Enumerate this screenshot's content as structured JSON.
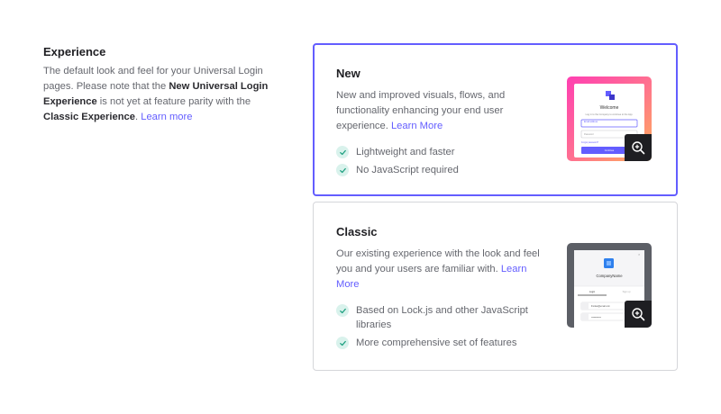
{
  "experience": {
    "title": "Experience",
    "desc_1": "The default look and feel for your Universal Login pages. Please note that the ",
    "desc_bold_1": "New Universal Login Experience",
    "desc_2": " is not yet at feature parity with the ",
    "desc_bold_2": "Classic Experience",
    "desc_3": ". ",
    "learn_more": "Learn more"
  },
  "new_card": {
    "title": "New",
    "description": "New and improved visuals, flows, and functionality enhancing your end user experience. ",
    "learn_more": "Learn More",
    "features": [
      "Lightweight and faster",
      "No JavaScript required"
    ],
    "preview": {
      "welcome": "Welcome",
      "subtitle": "Log in to the Company to continue to the App.",
      "email_label": "Email address",
      "password_label": "Password",
      "forgot": "Forgot password?",
      "button": "Continue"
    }
  },
  "classic_card": {
    "title": "Classic",
    "description": "Our existing experience with the look and feel you and your users are familiar with. ",
    "learn_more": "Learn More",
    "features": [
      "Based on Lock.js and other JavaScript libraries",
      "More comprehensive set of features"
    ],
    "preview": {
      "company": "CompanyName",
      "tab_login": "Login",
      "tab_signup": "Sign up",
      "email_value": "firstlast@email.com",
      "password_value": "••••••••••••"
    }
  },
  "colors": {
    "accent": "#635dff",
    "check_bg": "#d9f2ec",
    "check": "#1a9e7e"
  }
}
